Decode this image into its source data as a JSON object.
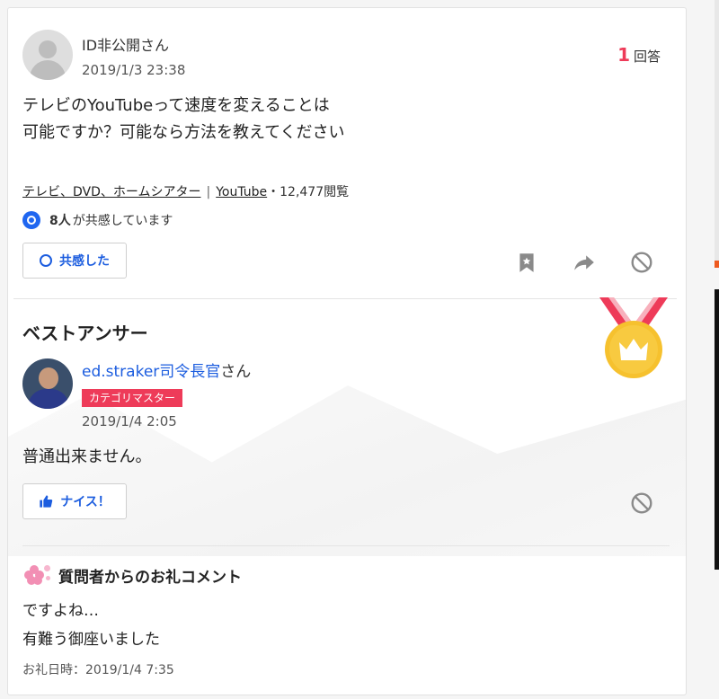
{
  "question": {
    "user_name": "ID非公開さん",
    "date": "2019/1/3 23:38",
    "answer_count": "1",
    "answer_label": "回答",
    "text": "テレビのYouTubeって速度を変えることは\n可能ですか？可能なら方法を教えてください",
    "category": "テレビ、DVD、ホームシアター",
    "category_sep": "|",
    "tag": "YouTube",
    "views": "・12,477閲覧",
    "empathy_count": "8人",
    "empathy_suffix": "が共感しています",
    "empathy_button": "共感した"
  },
  "best_answer": {
    "section_title": "ベストアンサー",
    "user_name": "ed.straker司令長官",
    "user_suffix": "さん",
    "badge": "カテゴリマスター",
    "date": "2019/1/4 2:05",
    "text": "普通出来ません。",
    "nice_button": "ナイス！"
  },
  "thanks": {
    "title": "質問者からのお礼コメント",
    "text": "ですよね…\n有難う御座いました",
    "date": "お礼日時：2019/1/4 7:35"
  },
  "icons": {
    "bookmark": "bookmark-icon",
    "share": "share-icon",
    "block": "block-icon",
    "medal": "medal-icon",
    "flower": "flower-icon"
  },
  "colors": {
    "accent_blue": "#1c5ddf",
    "accent_red": "#ee3b59",
    "medal_gold": "#f6c12e"
  }
}
